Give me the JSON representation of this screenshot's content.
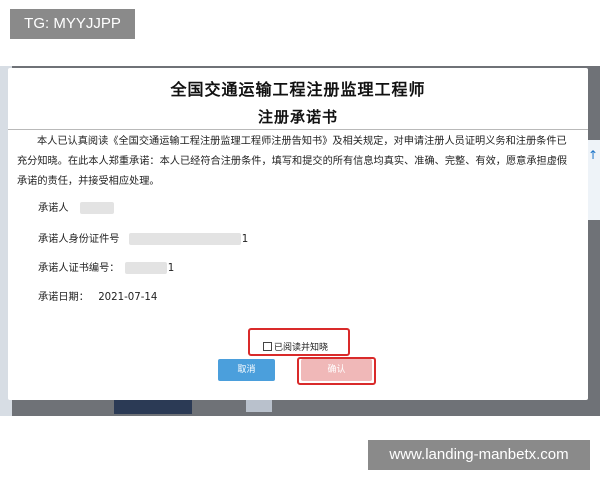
{
  "watermark_top": "TG: MYYJJPP",
  "watermark_bottom": "www.landing-manbetx.com",
  "dialog": {
    "title_line1": "全国交通运输工程注册监理工程师",
    "title_line2": "注册承诺书",
    "body": "本人已认真阅读《全国交通运输工程注册监理工程师注册告知书》及相关规定，对申请注册人员证明义务和注册条件已充分知晓。在此本人郑重承诺：本人已经符合注册条件，填写和提交的所有信息均真实、准确、完整、有效，愿意承担虚假承诺的责任，并接受相应处理。",
    "fields": {
      "promiser_label": "承诺人",
      "id_label": "承诺人身份证件号",
      "id_tail": "1",
      "cert_label": "承诺人证书编号：",
      "cert_tail": "1",
      "date_label": "承诺日期：",
      "date_value": "2021-07-14"
    },
    "agree_label": "已阅读并知晓",
    "cancel_label": "取消",
    "confirm_label": "确认"
  },
  "colors": {
    "accent_blue": "#4b9fdc",
    "highlight_red": "#d92a2a",
    "overlay": "#6f7277"
  }
}
